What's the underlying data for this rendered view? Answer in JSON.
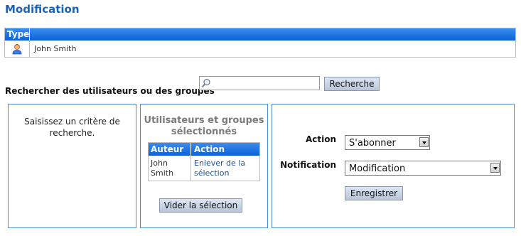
{
  "page": {
    "title": "Modification"
  },
  "type_table": {
    "header": "Type",
    "rows": [
      {
        "icon": "user-icon",
        "name": "John Smith"
      }
    ]
  },
  "search": {
    "label": "Rechercher des utilisateurs ou des groupes",
    "placeholder": "",
    "value": "",
    "button": "Recherche"
  },
  "results": {
    "hint_line1": "Saisissez un critère de",
    "hint_line2": "recherche."
  },
  "selected": {
    "title_line1": "Utilisateurs et groupes",
    "title_line2": "sélectionnés",
    "columns": [
      "Auteur",
      "Action"
    ],
    "rows": [
      {
        "author_line1": "John",
        "author_line2": "Smith",
        "action_line1": "Enlever de la",
        "action_line2": "sélection"
      }
    ],
    "clear_button": "Vider la sélection"
  },
  "settings": {
    "action_label": "Action",
    "action_value": "S'abonner",
    "notification_label": "Notification",
    "notification_value": "Modification",
    "save_button": "Enregistrer"
  },
  "colors": {
    "accent": "#1a63b5",
    "header_bg": "#0a62d6",
    "panel_border": "#4a8fd4",
    "button_bg": "#c9d4e4"
  }
}
